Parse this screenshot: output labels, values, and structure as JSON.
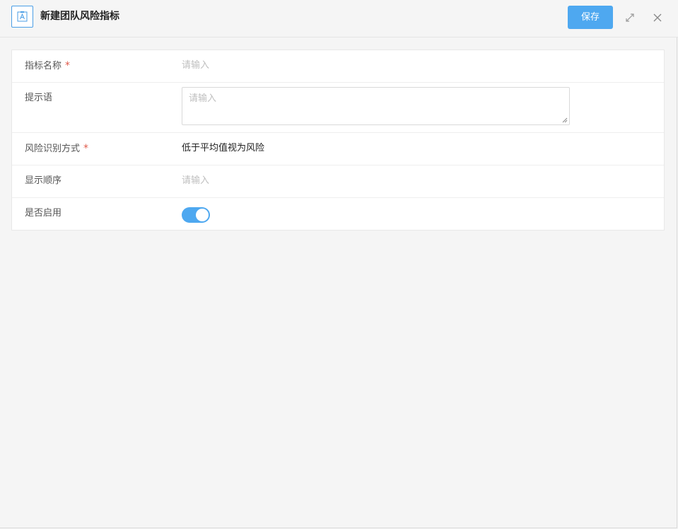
{
  "header": {
    "title": "新建团队风险指标",
    "save_label": "保存",
    "icons": {
      "app": "contact-card-icon",
      "expand": "expand-icon",
      "close": "close-icon"
    }
  },
  "form": {
    "indicator_name": {
      "label": "指标名称",
      "required_mark": "*",
      "placeholder": "请输入"
    },
    "hint": {
      "label": "提示语",
      "placeholder": "请输入"
    },
    "risk_method": {
      "label": "风险识别方式",
      "required_mark": "*",
      "value": "低于平均值视为风险"
    },
    "display_order": {
      "label": "显示顺序",
      "placeholder": "请输入"
    },
    "enabled": {
      "label": "是否启用",
      "on": true
    }
  },
  "colors": {
    "accent": "#4ea8f0",
    "required": "#e05a4b"
  }
}
